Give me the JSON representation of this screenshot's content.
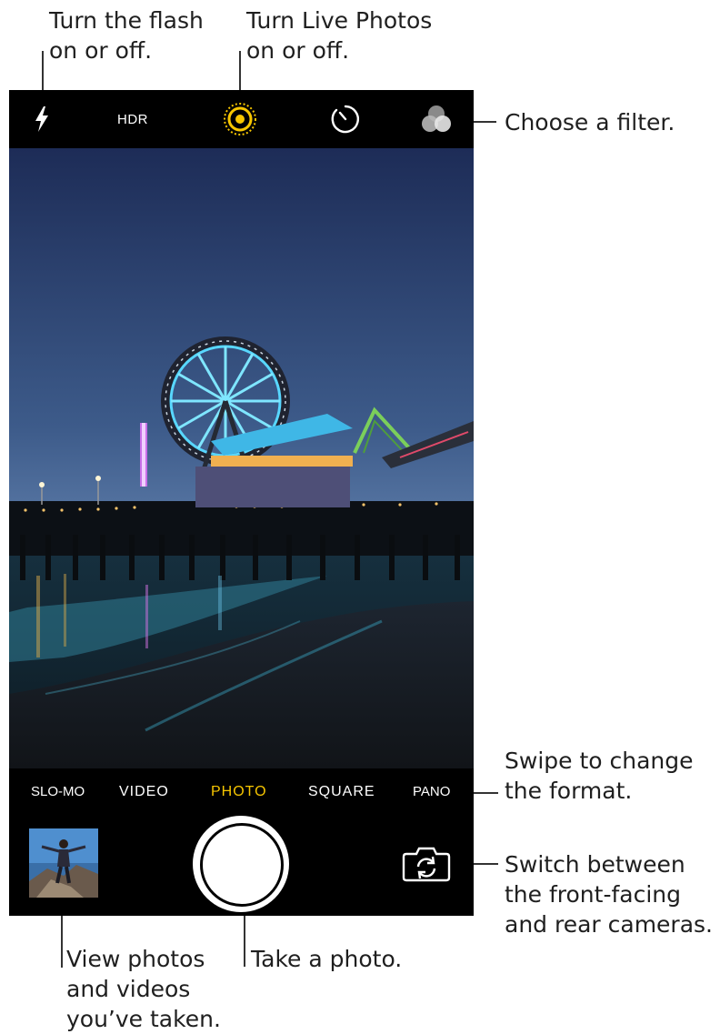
{
  "callouts": {
    "flash": [
      "Turn the flash",
      "on or off."
    ],
    "live": [
      "Turn Live Photos",
      "on or off."
    ],
    "filter": "Choose a filter.",
    "format": [
      "Swipe to change",
      "the format."
    ],
    "switch": [
      "Switch between",
      "the front-facing",
      "and rear cameras."
    ],
    "library": [
      "View photos",
      "and videos",
      "you’ve taken."
    ],
    "shutter": "Take a photo."
  },
  "camera": {
    "top_bar": {
      "flash_icon": "flash-icon",
      "hdr_label": "HDR",
      "live_photo_icon": "live-photo-icon",
      "timer_icon": "timer-icon",
      "filter_icon": "filter-icon"
    },
    "modes": [
      {
        "label": "SLO-MO",
        "active": false
      },
      {
        "label": "VIDEO",
        "active": false
      },
      {
        "label": "PHOTO",
        "active": true
      },
      {
        "label": "SQUARE",
        "active": false
      },
      {
        "label": "PANO",
        "active": false
      }
    ],
    "bottom_bar": {
      "thumbnail": "last-photo-thumbnail",
      "shutter_icon": "shutter-button",
      "switch_icon": "camera-switch-icon"
    }
  },
  "colors": {
    "active_mode": "#f7c600",
    "bar_background": "#000000"
  }
}
